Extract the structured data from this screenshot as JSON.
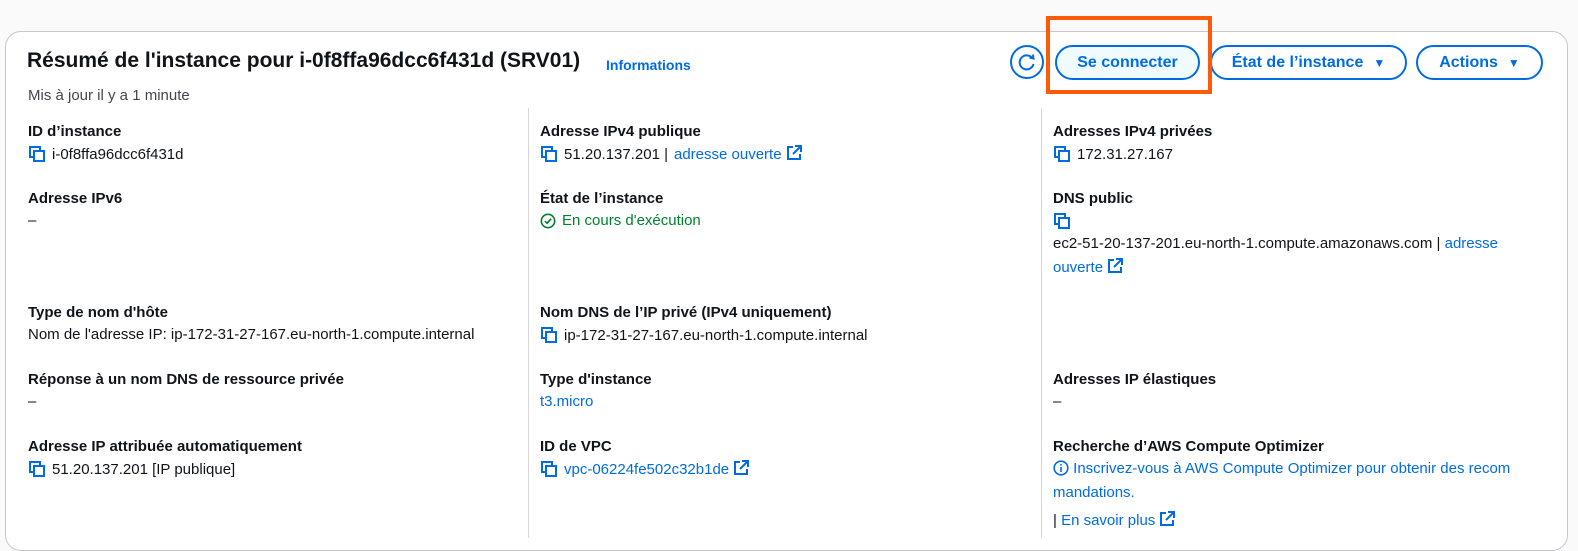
{
  "header": {
    "title": "Résumé de l'instance pour i-0f8ffa96dcc6f431d (SRV01)",
    "info_link": "Informations",
    "subtitle": "Mis à jour il y a 1 minute",
    "connect_button": "Se connecter",
    "state_button": "État de l’instance",
    "actions_button": "Actions",
    "refresh_icon": "refresh-icon",
    "highlight_color": "#ff5a0a"
  },
  "col1": {
    "instance_id": {
      "label": "ID d’instance",
      "value": "i-0f8ffa96dcc6f431d"
    },
    "ipv6": {
      "label": "Adresse IPv6",
      "value": "–"
    },
    "hostname_type": {
      "label": "Type de nom d'hôte",
      "value": "Nom de l'adresse IP: ip-172-31-27-167.eu-north-1.compute.internal"
    },
    "private_dns_response": {
      "label": "Réponse à un nom DNS de ressource privée",
      "value": "–"
    },
    "auto_ip": {
      "label": "Adresse IP attribuée automatiquement",
      "value": "51.20.137.201 [IP publique]"
    }
  },
  "col2": {
    "public_ipv4": {
      "label": "Adresse IPv4 publique",
      "value": "51.20.137.201 |",
      "link": "adresse ouverte"
    },
    "instance_state": {
      "label": "État de l’instance",
      "value": "En cours d'exécution"
    },
    "private_dns_name": {
      "label": "Nom DNS de l’IP privé (IPv4 uniquement)",
      "value": "ip-172-31-27-167.eu-north-1.compute.internal"
    },
    "instance_type": {
      "label": "Type d'instance",
      "value": "t3.micro"
    },
    "vpc_id": {
      "label": "ID de VPC",
      "value": "vpc-06224fe502c32b1de"
    }
  },
  "col3": {
    "private_ipv4": {
      "label": "Adresses IPv4 privées",
      "value": "172.31.27.167"
    },
    "public_dns": {
      "label": "DNS public",
      "value": "ec2-51-20-137-201.eu-north-1.compute.amazonaws.com |",
      "link_line1": "adresse",
      "link_line2": "ouverte"
    },
    "elastic_ip": {
      "label": "Adresses IP élastiques",
      "value": "–"
    },
    "compute_optimizer": {
      "label": "Recherche d’AWS Compute Optimizer",
      "line1": "Inscrivez-vous à AWS Compute Optimizer pour obtenir des recom",
      "line2": "mandations.",
      "sep": "|",
      "learn_more": "En savoir plus"
    }
  },
  "colors": {
    "link": "#006ce0",
    "running": "#00802f",
    "text": "#0f141a"
  }
}
